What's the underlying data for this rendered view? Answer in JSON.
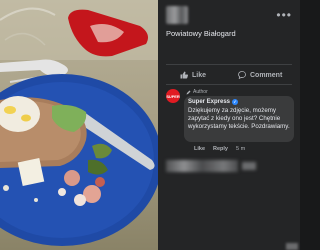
{
  "post": {
    "caption": "Powiatowy Białogard",
    "more_icon": "more-horizontal-icon"
  },
  "actions": {
    "like_label": "Like",
    "comment_label": "Comment"
  },
  "comment": {
    "author_badge": "Author",
    "page_avatar_text": "SUPER",
    "author_name": "Super Express",
    "verified_icon": "verified-badge-icon",
    "text": "Dziękujemy za zdjęcie, możemy zapytać z kiedy ono jest? Chętnie wykorzystamy tekście. Pozdrawiamy.",
    "like_label": "Like",
    "reply_label": "Reply",
    "time": "5 m"
  },
  "colors": {
    "background": "#242526",
    "bubble": "#3a3b3c",
    "brand_red": "#e11b22",
    "plate_blue": "#1f4aa6",
    "verified_blue": "#2d88ff"
  }
}
